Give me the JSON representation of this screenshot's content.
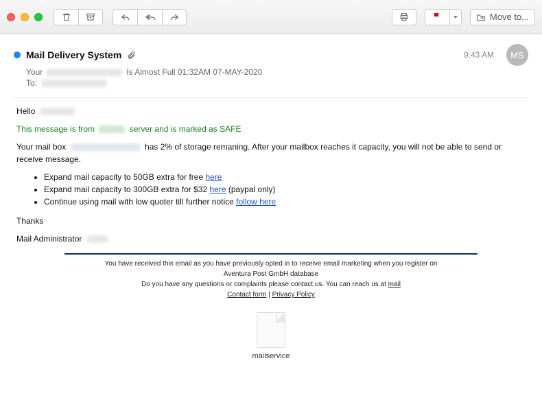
{
  "toolbar": {
    "moveto_label": "Move to..."
  },
  "header": {
    "sender": "Mail Delivery System",
    "time": "9:43 AM",
    "avatar_initials": "MS",
    "subject_prefix": "Your",
    "subject_suffix": "Is Almost Full 01:32AM  07-MAY-2020",
    "to_label": "To:"
  },
  "body": {
    "hello": "Hello",
    "safe_prefix": "This message is from",
    "safe_suffix": "server and is marked as SAFE",
    "storage_prefix": "Your mail box",
    "storage_suffix": "has 2% of storage remaning. After your mailbox reaches it capacity, you will not be able to send or receive message.",
    "bullets": [
      {
        "text": "Expand mail capacity to 50GB extra for free ",
        "link": "here"
      },
      {
        "text": "Expand mail capacity to 300GB extra for $32 ",
        "link": "here",
        "after": " (paypal only)"
      },
      {
        "text": "Continue using mail with low quoter till further notice ",
        "link": "follow here"
      }
    ],
    "thanks": "Thanks",
    "signoff": "Mail Administrator"
  },
  "footer": {
    "line1": "You have received this email as you have previously opted in to receive email marketing when you register on",
    "line2": "Aventura Post GmbH database",
    "line3_a": "Do you have any questions or complaints please contact us. You can reach us at ",
    "line3_link": "mail",
    "contact": "Contact form",
    "privacy": "Privacy Policy",
    "sep": " | "
  },
  "attachment": {
    "name": "mailservice"
  }
}
